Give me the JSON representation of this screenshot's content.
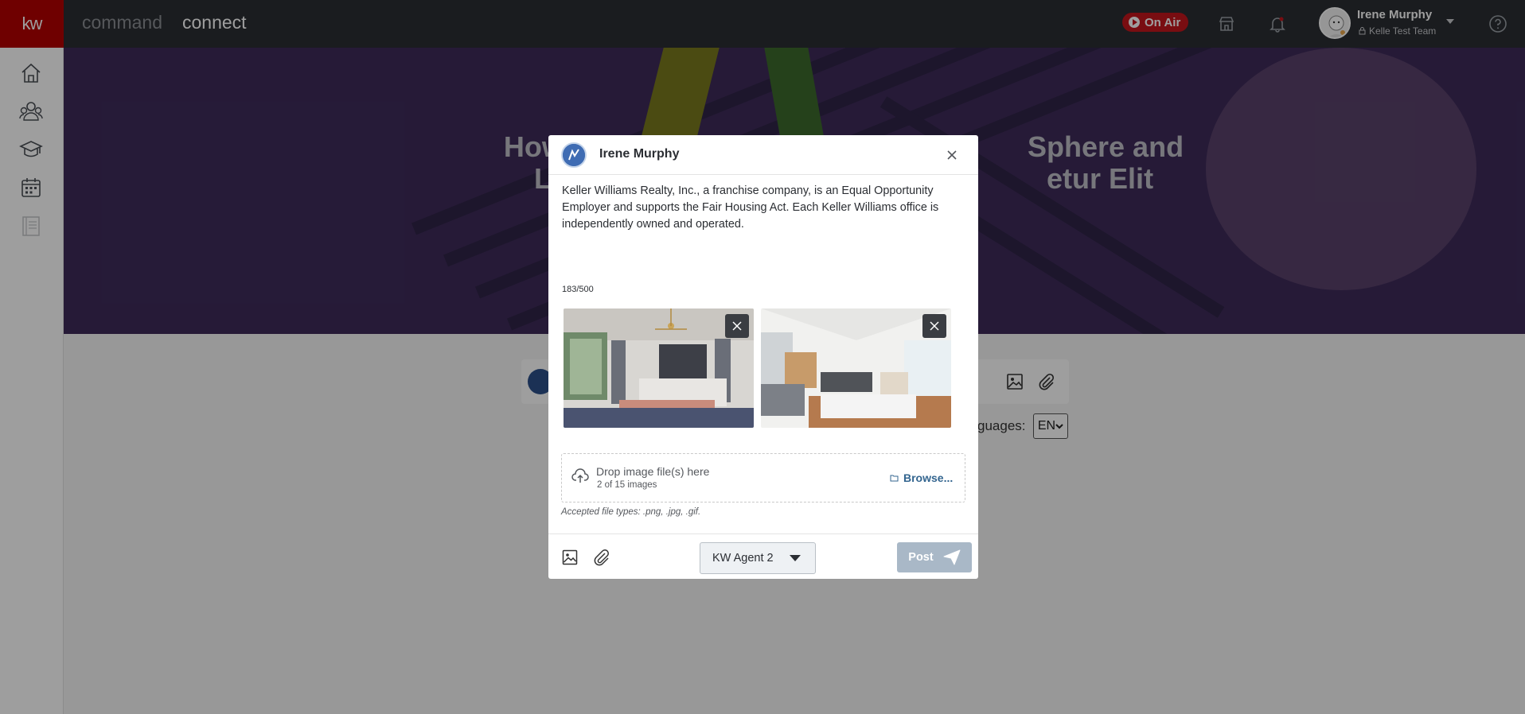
{
  "topbar": {
    "logo": "kw",
    "brand_command": "command",
    "brand_connect": "connect",
    "on_air_label": "On Air",
    "user_name": "Irene Murphy",
    "user_team": "Kelle Test Team",
    "icons": [
      "store-icon",
      "bell-icon",
      "help-icon"
    ],
    "on_air_color": "#c4161c"
  },
  "sidebar": {
    "items": [
      {
        "icon": "home-icon"
      },
      {
        "icon": "people-icon"
      },
      {
        "icon": "graduation-cap-icon"
      },
      {
        "icon": "calendar-icon"
      },
      {
        "icon": "document-icon"
      }
    ]
  },
  "hero": {
    "title_line1": "How t                                                        Sphere and",
    "title_line2": "Lo                                                            etur Elit"
  },
  "feed": {
    "languages_label": "guages:",
    "language_value": "EN"
  },
  "modal": {
    "author_name": "Irene Murphy",
    "post_text": "Keller Williams Realty, Inc., a franchise company, is an Equal Opportunity Employer and supports the Fair Housing Act. Each Keller Williams office is independently owned and operated.",
    "char_count": "183/500",
    "images": [
      {
        "alt": "bedroom-photo"
      },
      {
        "alt": "living-room-photo"
      }
    ],
    "drop_title": "Drop image file(s) here",
    "drop_sub": "2 of 15 images",
    "browse_label": "Browse...",
    "accepted_types": "Accepted file types: .png, .jpg, .gif.",
    "agent_select_value": "KW Agent 2",
    "post_label": "Post",
    "post_button_color": "#a9b8c7"
  }
}
